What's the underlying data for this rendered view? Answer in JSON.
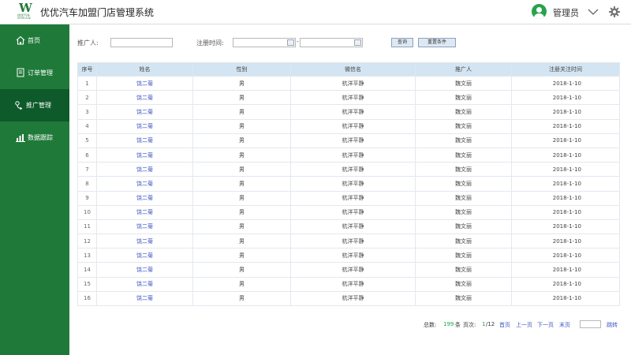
{
  "app": {
    "logo_letter": "W",
    "logo_text_cn": "优优汽车",
    "logo_text_en": "UUYOUCAR",
    "title": "优优汽车加盟门店管理系统",
    "user_name": "管理员"
  },
  "sidebar": {
    "items": [
      {
        "label": "首页",
        "icon": "home-icon"
      },
      {
        "label": "订单管理",
        "icon": "order-icon"
      },
      {
        "label": "推广管理",
        "icon": "promotion-icon"
      },
      {
        "label": "数据跟踪",
        "icon": "chart-icon"
      }
    ],
    "active_index": 2
  },
  "filters": {
    "promoter_label": "推广人:",
    "promoter_value": "",
    "reg_time_label": "注册时间:",
    "date_start": "",
    "date_end": "",
    "range_dash": "-",
    "query_button": "查询",
    "reset_button": "重置条件"
  },
  "table": {
    "headers": [
      "序号",
      "姓名",
      "性别",
      "微信名",
      "推广人",
      "注册关注时间"
    ],
    "rows": [
      {
        "no": "1",
        "name": "饶二菊",
        "gender": "男",
        "wechat": "杭洋平静",
        "promoter": "魏文丽",
        "date": "2018-1-10"
      },
      {
        "no": "2",
        "name": "饶二菊",
        "gender": "男",
        "wechat": "杭洋平静",
        "promoter": "魏文丽",
        "date": "2018-1-10"
      },
      {
        "no": "3",
        "name": "饶二菊",
        "gender": "男",
        "wechat": "杭洋平静",
        "promoter": "魏文丽",
        "date": "2018-1-10"
      },
      {
        "no": "4",
        "name": "饶二菊",
        "gender": "男",
        "wechat": "杭洋平静",
        "promoter": "魏文丽",
        "date": "2018-1-10"
      },
      {
        "no": "5",
        "name": "饶二菊",
        "gender": "男",
        "wechat": "杭洋平静",
        "promoter": "魏文丽",
        "date": "2018-1-10"
      },
      {
        "no": "6",
        "name": "饶二菊",
        "gender": "男",
        "wechat": "杭洋平静",
        "promoter": "魏文丽",
        "date": "2018-1-10"
      },
      {
        "no": "7",
        "name": "饶二菊",
        "gender": "男",
        "wechat": "杭洋平静",
        "promoter": "魏文丽",
        "date": "2018-1-10"
      },
      {
        "no": "8",
        "name": "饶二菊",
        "gender": "男",
        "wechat": "杭洋平静",
        "promoter": "魏文丽",
        "date": "2018-1-10"
      },
      {
        "no": "9",
        "name": "饶二菊",
        "gender": "男",
        "wechat": "杭洋平静",
        "promoter": "魏文丽",
        "date": "2018-1-10"
      },
      {
        "no": "10",
        "name": "饶二菊",
        "gender": "男",
        "wechat": "杭洋平静",
        "promoter": "魏文丽",
        "date": "2018-1-10"
      },
      {
        "no": "11",
        "name": "饶二菊",
        "gender": "男",
        "wechat": "杭洋平静",
        "promoter": "魏文丽",
        "date": "2018-1-10"
      },
      {
        "no": "12",
        "name": "饶二菊",
        "gender": "男",
        "wechat": "杭洋平静",
        "promoter": "魏文丽",
        "date": "2018-1-10"
      },
      {
        "no": "13",
        "name": "饶二菊",
        "gender": "男",
        "wechat": "杭洋平静",
        "promoter": "魏文丽",
        "date": "2018-1-10"
      },
      {
        "no": "14",
        "name": "饶二菊",
        "gender": "男",
        "wechat": "杭洋平静",
        "promoter": "魏文丽",
        "date": "2018-1-10"
      },
      {
        "no": "15",
        "name": "饶二菊",
        "gender": "男",
        "wechat": "杭洋平静",
        "promoter": "魏文丽",
        "date": "2018-1-10"
      },
      {
        "no": "16",
        "name": "饶二菊",
        "gender": "男",
        "wechat": "杭洋平静",
        "promoter": "魏文丽",
        "date": "2018-1-10"
      }
    ]
  },
  "pager": {
    "total_label": "总数:",
    "total_value": "199",
    "total_unit": "条",
    "page_label": "页次:",
    "current_page": "1",
    "total_pages": "/12",
    "first": "首页",
    "prev": "上一页",
    "next": "下一页",
    "last": "末页",
    "jump": "跳转"
  },
  "colors": {
    "brand_green": "#1f7a3a",
    "sidebar_active": "#0e5a2a",
    "header_row": "#d3e5f2",
    "link_blue": "#3d55c4"
  }
}
